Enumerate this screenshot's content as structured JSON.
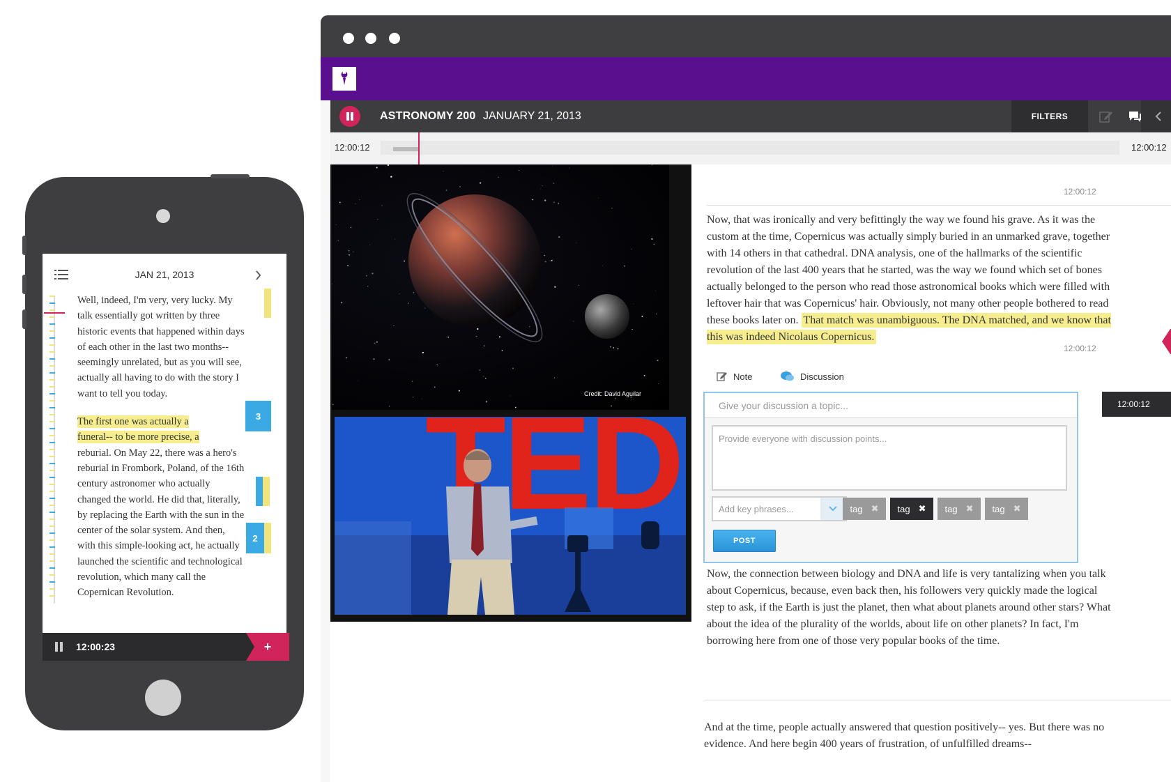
{
  "phone": {
    "date": "JAN 21, 2013",
    "paragraph1": "Well, indeed, I'm very, very lucky. My talk essentially got written by three historic events that happened within days of each other in the last two months-- seemingly unrelated, but as you will see, actually all having to do with the story I want to tell you today.",
    "paragraph2_highlight_a": "The first one was actually a",
    "paragraph2_highlight_b": "funeral-- to be more precise, a",
    "paragraph2_rest": "reburial. On May 22, there was a hero's reburial in Frombork, Poland, of the 16th century astronomer who actually changed the world. He did that, literally, by replacing the Earth with the sun in the center of the solar system. And then, with this simple-looking act, he actually launched the scientific and technological revolution, which many call the Copernican Revolution.",
    "badge1": "3",
    "badge2": "2",
    "time": "12:00:23",
    "add_label": "+",
    "icons": [
      "list-menu-icon",
      "chevron-right-icon",
      "pause-icon",
      "plus-icon"
    ],
    "colors": {
      "highlight": "#f6ed8e",
      "accent": "#d0245a",
      "badge": "#3aa9e4"
    }
  },
  "app": {
    "course": "ASTRONOMY 200",
    "date": "JANUARY 21, 2013",
    "filters_label": "FILTERS",
    "timeline_start": "12:00:12",
    "timeline_end": "12:00:12",
    "slide_credit": "Credit: David Aguilar",
    "ted_label": "TED",
    "colors": {
      "brand_purple": "#5a0f8e",
      "accent": "#d0245a",
      "bar": "#3d3d3f",
      "link_blue": "#3aa0e0"
    }
  },
  "transcript": {
    "ts_top": "12:00:12",
    "paragraph1_start": "Now, that was ironically and very befittingly the way we found his grave. As it was the custom at the time, Copernicus was actually simply buried in an unmarked grave, together with 14 others in that cathedral. DNA analysis, one of the hallmarks of the scientific revolution of the last 400 years that he started, was the way we found which set of bones actually belonged to the person who read those astronomical books which were filled with leftover hair that was Copernicus' hair. Obviously, not many other people bothered to read these books later on.",
    "paragraph1_highlight": "That match was unambiguous. The DNA matched, and we know that this was indeed Nicolaus Copernicus.",
    "ts_mid": "12:00:12",
    "paragraph2": "Now, the connection between biology and DNA and life is very tantalizing when you talk about Copernicus, because, even back then, his followers very quickly made the logical step to ask, if the Earth is just the planet, then what about planets around other stars? What about the idea of the plurality of the worlds, about life on other planets? In fact, I'm borrowing here from one of those very popular books of the time.",
    "paragraph3": "And at the time, people actually answered that question positively-- yes. But there was no evidence. And here begin 400 years of frustration, of unfulfilled dreams--"
  },
  "compose": {
    "tab_note": "Note",
    "tab_discussion": "Discussion",
    "topic_placeholder": "Give your discussion a topic...",
    "points_placeholder": "Provide everyone with discussion points...",
    "phrase_placeholder": "Add key phrases...",
    "tags": [
      "tag",
      "tag",
      "tag",
      "tag"
    ],
    "post_label": "POST",
    "side_timestamp": "12:00:12"
  }
}
